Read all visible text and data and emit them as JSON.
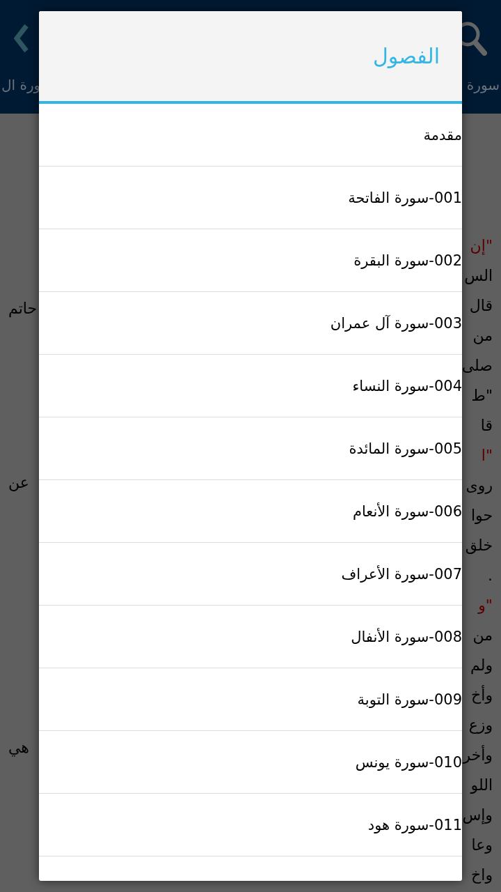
{
  "app_bar": {
    "tabs": [
      "سورة",
      "ورة ال"
    ]
  },
  "background_text": {
    "right": [
      {
        "text": "\"إن",
        "kind": "quote"
      },
      {
        "text": "الس",
        "kind": "plain"
      },
      {
        "text": "قال",
        "kind": "plain"
      },
      {
        "text": "من",
        "kind": "plain"
      },
      {
        "text": "صلى",
        "kind": "plain"
      },
      {
        "text": "\"ط",
        "kind": "plain"
      },
      {
        "text": "قا",
        "kind": "plain"
      },
      {
        "text": "\"ا",
        "kind": "quote"
      },
      {
        "text": "روى",
        "kind": "plain"
      },
      {
        "text": "حوا",
        "kind": "plain"
      },
      {
        "text": "خلق",
        "kind": "plain"
      },
      {
        "text": ".",
        "kind": "plain"
      },
      {
        "text": "\"و",
        "kind": "quote"
      },
      {
        "text": "من",
        "kind": "plain"
      },
      {
        "text": "ولم",
        "kind": "plain"
      },
      {
        "text": "وأخ",
        "kind": "plain"
      },
      {
        "text": "وزع",
        "kind": "plain"
      },
      {
        "text": "وأخر",
        "kind": "plain"
      },
      {
        "text": "اللو",
        "kind": "plain"
      },
      {
        "text": "وإس",
        "kind": "plain"
      },
      {
        "text": "وعا",
        "kind": "plain"
      },
      {
        "text": "واخ",
        "kind": "plain"
      }
    ],
    "left": [
      "حاتم",
      "عن",
      "هي"
    ]
  },
  "dialog": {
    "title": "الفصول",
    "items": [
      "مقدمة",
      "001-سورة الفاتحة",
      "002-سورة البقرة",
      "003-سورة آل عمران",
      "004-سورة النساء",
      "005-سورة المائدة",
      "006-سورة الأنعام",
      "007-سورة الأعراف",
      "008-سورة الأنفال",
      "009-سورة التوبة",
      "010-سورة يونس",
      "011-سورة هود"
    ]
  }
}
